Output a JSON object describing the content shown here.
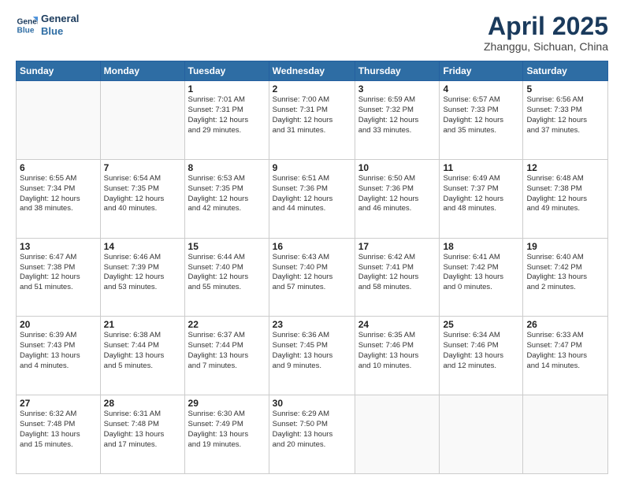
{
  "header": {
    "logo_line1": "General",
    "logo_line2": "Blue",
    "month": "April 2025",
    "location": "Zhanggu, Sichuan, China"
  },
  "days_of_week": [
    "Sunday",
    "Monday",
    "Tuesday",
    "Wednesday",
    "Thursday",
    "Friday",
    "Saturday"
  ],
  "weeks": [
    [
      {
        "day": "",
        "info": ""
      },
      {
        "day": "",
        "info": ""
      },
      {
        "day": "1",
        "info": "Sunrise: 7:01 AM\nSunset: 7:31 PM\nDaylight: 12 hours\nand 29 minutes."
      },
      {
        "day": "2",
        "info": "Sunrise: 7:00 AM\nSunset: 7:31 PM\nDaylight: 12 hours\nand 31 minutes."
      },
      {
        "day": "3",
        "info": "Sunrise: 6:59 AM\nSunset: 7:32 PM\nDaylight: 12 hours\nand 33 minutes."
      },
      {
        "day": "4",
        "info": "Sunrise: 6:57 AM\nSunset: 7:33 PM\nDaylight: 12 hours\nand 35 minutes."
      },
      {
        "day": "5",
        "info": "Sunrise: 6:56 AM\nSunset: 7:33 PM\nDaylight: 12 hours\nand 37 minutes."
      }
    ],
    [
      {
        "day": "6",
        "info": "Sunrise: 6:55 AM\nSunset: 7:34 PM\nDaylight: 12 hours\nand 38 minutes."
      },
      {
        "day": "7",
        "info": "Sunrise: 6:54 AM\nSunset: 7:35 PM\nDaylight: 12 hours\nand 40 minutes."
      },
      {
        "day": "8",
        "info": "Sunrise: 6:53 AM\nSunset: 7:35 PM\nDaylight: 12 hours\nand 42 minutes."
      },
      {
        "day": "9",
        "info": "Sunrise: 6:51 AM\nSunset: 7:36 PM\nDaylight: 12 hours\nand 44 minutes."
      },
      {
        "day": "10",
        "info": "Sunrise: 6:50 AM\nSunset: 7:36 PM\nDaylight: 12 hours\nand 46 minutes."
      },
      {
        "day": "11",
        "info": "Sunrise: 6:49 AM\nSunset: 7:37 PM\nDaylight: 12 hours\nand 48 minutes."
      },
      {
        "day": "12",
        "info": "Sunrise: 6:48 AM\nSunset: 7:38 PM\nDaylight: 12 hours\nand 49 minutes."
      }
    ],
    [
      {
        "day": "13",
        "info": "Sunrise: 6:47 AM\nSunset: 7:38 PM\nDaylight: 12 hours\nand 51 minutes."
      },
      {
        "day": "14",
        "info": "Sunrise: 6:46 AM\nSunset: 7:39 PM\nDaylight: 12 hours\nand 53 minutes."
      },
      {
        "day": "15",
        "info": "Sunrise: 6:44 AM\nSunset: 7:40 PM\nDaylight: 12 hours\nand 55 minutes."
      },
      {
        "day": "16",
        "info": "Sunrise: 6:43 AM\nSunset: 7:40 PM\nDaylight: 12 hours\nand 57 minutes."
      },
      {
        "day": "17",
        "info": "Sunrise: 6:42 AM\nSunset: 7:41 PM\nDaylight: 12 hours\nand 58 minutes."
      },
      {
        "day": "18",
        "info": "Sunrise: 6:41 AM\nSunset: 7:42 PM\nDaylight: 13 hours\nand 0 minutes."
      },
      {
        "day": "19",
        "info": "Sunrise: 6:40 AM\nSunset: 7:42 PM\nDaylight: 13 hours\nand 2 minutes."
      }
    ],
    [
      {
        "day": "20",
        "info": "Sunrise: 6:39 AM\nSunset: 7:43 PM\nDaylight: 13 hours\nand 4 minutes."
      },
      {
        "day": "21",
        "info": "Sunrise: 6:38 AM\nSunset: 7:44 PM\nDaylight: 13 hours\nand 5 minutes."
      },
      {
        "day": "22",
        "info": "Sunrise: 6:37 AM\nSunset: 7:44 PM\nDaylight: 13 hours\nand 7 minutes."
      },
      {
        "day": "23",
        "info": "Sunrise: 6:36 AM\nSunset: 7:45 PM\nDaylight: 13 hours\nand 9 minutes."
      },
      {
        "day": "24",
        "info": "Sunrise: 6:35 AM\nSunset: 7:46 PM\nDaylight: 13 hours\nand 10 minutes."
      },
      {
        "day": "25",
        "info": "Sunrise: 6:34 AM\nSunset: 7:46 PM\nDaylight: 13 hours\nand 12 minutes."
      },
      {
        "day": "26",
        "info": "Sunrise: 6:33 AM\nSunset: 7:47 PM\nDaylight: 13 hours\nand 14 minutes."
      }
    ],
    [
      {
        "day": "27",
        "info": "Sunrise: 6:32 AM\nSunset: 7:48 PM\nDaylight: 13 hours\nand 15 minutes."
      },
      {
        "day": "28",
        "info": "Sunrise: 6:31 AM\nSunset: 7:48 PM\nDaylight: 13 hours\nand 17 minutes."
      },
      {
        "day": "29",
        "info": "Sunrise: 6:30 AM\nSunset: 7:49 PM\nDaylight: 13 hours\nand 19 minutes."
      },
      {
        "day": "30",
        "info": "Sunrise: 6:29 AM\nSunset: 7:50 PM\nDaylight: 13 hours\nand 20 minutes."
      },
      {
        "day": "",
        "info": ""
      },
      {
        "day": "",
        "info": ""
      },
      {
        "day": "",
        "info": ""
      }
    ]
  ]
}
